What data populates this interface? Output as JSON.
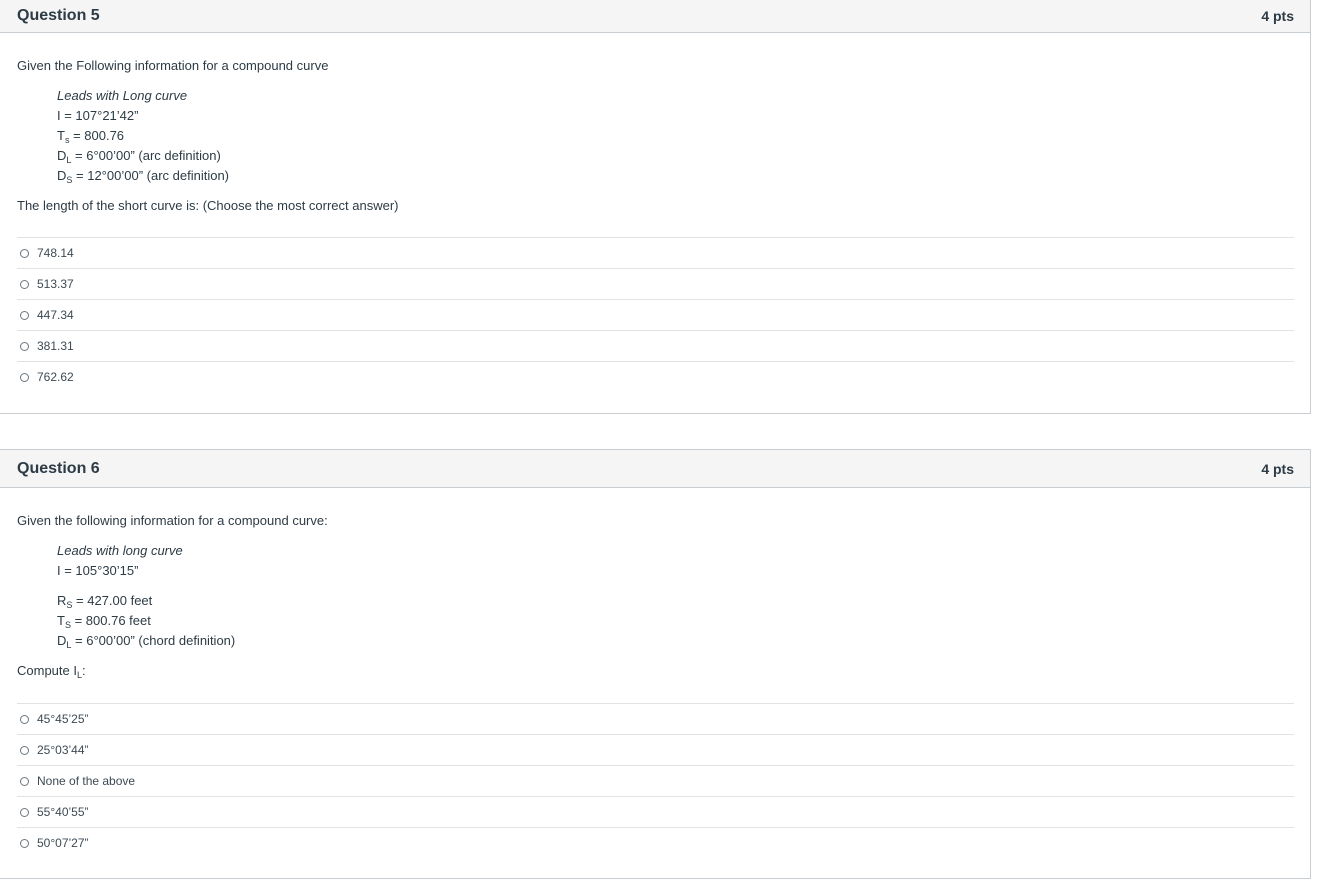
{
  "q5": {
    "title": "Question 5",
    "points": "4 pts",
    "intro": "Given the Following information for a compound curve",
    "lead": "Leads with Long curve",
    "i_line": "I = 107°21’42”",
    "ts_main": "T",
    "ts_sub": "s",
    "ts_rest": " = 800.76",
    "dl_main": "D",
    "dl_sub": "L",
    "dl_rest": " = 6°00’00” (arc definition)",
    "ds_main": "D",
    "ds_sub": "S",
    "ds_rest": " = 12°00’00” (arc definition)",
    "prompt": "The length of the short curve is:  (Choose the most correct answer)",
    "answers": [
      "748.14",
      "513.37",
      "447.34",
      "381.31",
      "762.62"
    ]
  },
  "q6": {
    "title": "Question 6",
    "points": "4 pts",
    "intro": "Given the following information for a compound curve:",
    "lead": "Leads with long curve",
    "i_line": "I = 105°30’15”",
    "rs_main": "R",
    "rs_sub": "S",
    "rs_rest": " = 427.00 feet",
    "ts_main": "T",
    "ts_sub": "S",
    "ts_rest": " = 800.76 feet",
    "dl_main": "D",
    "dl_sub": "L",
    "dl_rest": " = 6°00’00” (chord definition)",
    "prompt_main": "Compute I",
    "prompt_sub": "L",
    "prompt_rest": ":",
    "answers": [
      "45°45’25”",
      "25°03’44”",
      "None of the above",
      "55°40’55”",
      "50°07’27”"
    ]
  }
}
